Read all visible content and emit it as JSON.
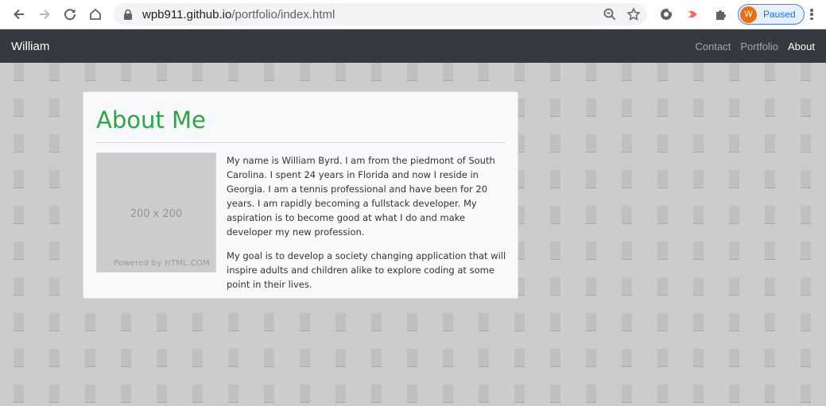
{
  "browser": {
    "url_host": "wpb911.github.io",
    "url_path": "/portfolio/index.html",
    "profile_initial": "W",
    "profile_status": "Paused",
    "colors": {
      "profile": "#e8710a",
      "accent": "#1a73e8"
    }
  },
  "navbar": {
    "brand": "William",
    "links": [
      {
        "label": "Contact"
      },
      {
        "label": "Portfolio"
      },
      {
        "label": "About"
      }
    ],
    "active": "About"
  },
  "card": {
    "title": "About Me",
    "placeholder": {
      "size_label": "200 x 200",
      "powered": "Powered by HTML.COM"
    },
    "paragraphs": [
      "My name is William Byrd. I am from the piedmont of South Carolina. I spent 24 years in Florida and now I reside in Georgia. I am a tennis professional and have been for 20 years. I am rapidly becoming a fullstack developer. My aspiration is to become good at what I do and make developer my new profession.",
      "My goal is to develop a society changing application that will inspire adults and children alike to explore coding at some point in their lives."
    ],
    "colors": {
      "title": "#28a745",
      "navbar": "#343a40"
    }
  }
}
